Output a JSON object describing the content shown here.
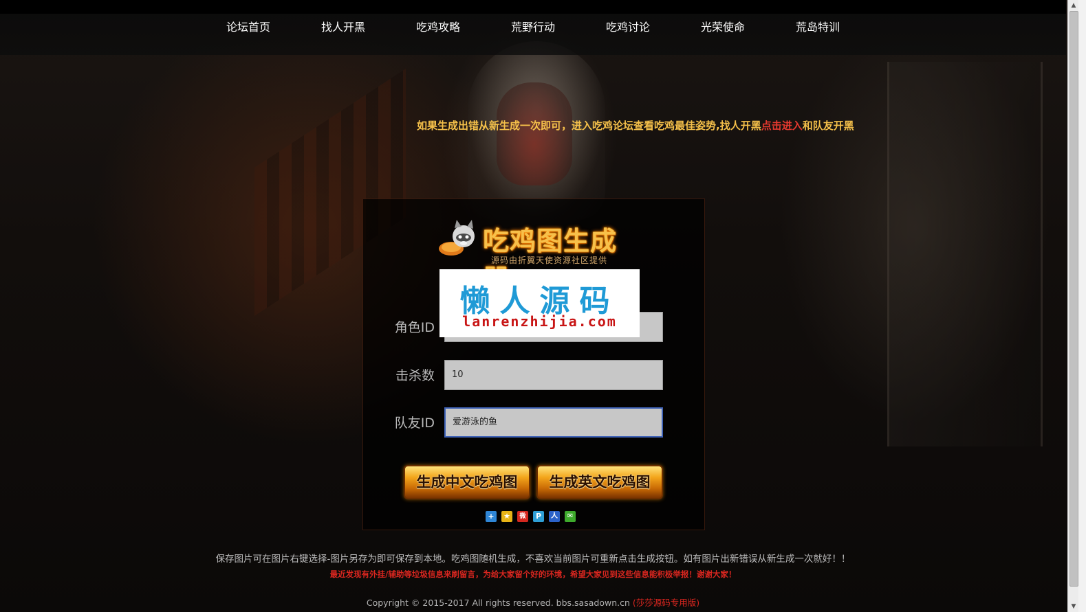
{
  "nav": {
    "items": [
      "论坛首页",
      "找人开黑",
      "吃鸡攻略",
      "荒野行动",
      "吃鸡讨论",
      "光荣使命",
      "荒岛特训"
    ]
  },
  "notice": {
    "text_before": "如果生成出错从新生成一次即可，进入吃鸡论坛查看吃鸡最佳姿势,找人开黑",
    "link": "点击进入",
    "text_after": "和队友开黑"
  },
  "logo": {
    "title": "吃鸡图生成器",
    "subtitle": "源码由折翼天使资源社区提供"
  },
  "watermark": {
    "title": "懒人源码",
    "url": "lanrenzhijia.com"
  },
  "form": {
    "role_id_label": "角色ID",
    "role_id_value": "",
    "kills_label": "击杀数",
    "kills_value": "10",
    "teammate_label": "队友ID",
    "teammate_value": "爱游泳的鱼"
  },
  "buttons": {
    "generate_cn": "生成中文吃鸡图",
    "generate_en": "生成英文吃鸡图"
  },
  "share_icons": [
    {
      "name": "share-more-icon",
      "glyph": "+",
      "color": "#2f86d6"
    },
    {
      "name": "qzone-icon",
      "glyph": "★",
      "color": "#e8b316"
    },
    {
      "name": "weibo-icon",
      "glyph": "微",
      "color": "#d4281f"
    },
    {
      "name": "tencent-weibo-icon",
      "glyph": "P",
      "color": "#2f9fd6"
    },
    {
      "name": "renren-icon",
      "glyph": "人",
      "color": "#2b62c9"
    },
    {
      "name": "wechat-icon",
      "glyph": "✉",
      "color": "#3eaa2c"
    }
  ],
  "footer": {
    "line1": "保存图片可在图片右键选择-图片另存为即可保存到本地。吃鸡图随机生成，不喜欢当前图片可重新点击生成按钮。如有图片出新错误从新生成一次就好！！",
    "line2": "最近发现有外挂/辅助等垃圾信息来刷留言，为给大家留个好的环境，希望大家见到这些信息能积极举报！谢谢大家！",
    "copyright": "Copyright © 2015-2017 All rights reserved. bbs.sasadown.cn",
    "copyright_note": "(莎莎源码专用版)"
  }
}
